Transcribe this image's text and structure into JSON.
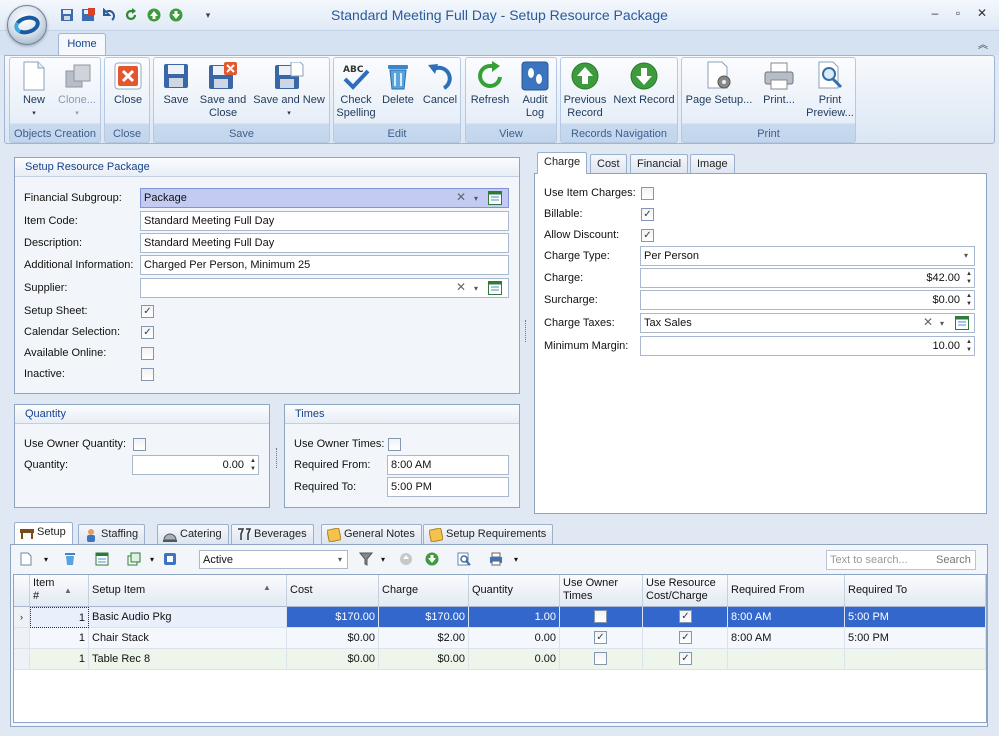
{
  "window": {
    "title": "Standard Meeting Full Day - Setup Resource Package",
    "minimize": "–",
    "maximize": "▫",
    "close": "✕"
  },
  "ribbon": {
    "tab_home": "Home",
    "groups": {
      "objects": "Objects Creation",
      "close": "Close",
      "save": "Save",
      "edit": "Edit",
      "view": "View",
      "nav": "Records Navigation",
      "print": "Print"
    },
    "buttons": {
      "new": "New",
      "clone": "Clone...",
      "close": "Close",
      "save": "Save",
      "save_close_1": "Save and",
      "save_close_2": "Close",
      "save_new": "Save and New",
      "check_1": "Check",
      "check_2": "Spelling",
      "delete": "Delete",
      "cancel": "Cancel",
      "refresh": "Refresh",
      "audit_1": "Audit",
      "audit_2": "Log",
      "prev_1": "Previous",
      "prev_2": "Record",
      "next": "Next Record",
      "page_setup": "Page Setup...",
      "print": "Print...",
      "preview_1": "Print",
      "preview_2": "Preview..."
    }
  },
  "setup_panel": {
    "title": "Setup Resource Package",
    "financial_subgroup_label": "Financial Subgroup:",
    "financial_subgroup": "Package",
    "item_code_label": "Item Code:",
    "item_code": "Standard Meeting Full Day",
    "description_label": "Description:",
    "description": "Standard Meeting Full Day",
    "additional_info_label": "Additional Information:",
    "additional_info": "Charged Per Person, Minimum 25",
    "supplier_label": "Supplier:",
    "supplier": "",
    "setup_sheet_label": "Setup Sheet:",
    "calendar_selection_label": "Calendar Selection:",
    "available_online_label": "Available Online:",
    "inactive_label": "Inactive:"
  },
  "quantity_panel": {
    "title": "Quantity",
    "use_owner_label": "Use Owner Quantity:",
    "quantity_label": "Quantity:",
    "quantity": "0.00"
  },
  "times_panel": {
    "title": "Times",
    "use_owner_label": "Use Owner Times:",
    "required_from_label": "Required From:",
    "required_from": "8:00 AM",
    "required_to_label": "Required To:",
    "required_to": "5:00 PM"
  },
  "charge_tabs": [
    "Charge",
    "Cost",
    "Financial",
    "Image"
  ],
  "charge_panel": {
    "use_item_charges_label": "Use Item Charges:",
    "billable_label": "Billable:",
    "allow_discount_label": "Allow Discount:",
    "charge_type_label": "Charge Type:",
    "charge_type": "Per Person",
    "charge_label": "Charge:",
    "charge": "$42.00",
    "surcharge_label": "Surcharge:",
    "surcharge": "$0.00",
    "charge_taxes_label": "Charge Taxes:",
    "charge_taxes": "Tax Sales",
    "minimum_margin_label": "Minimum Margin:",
    "minimum_margin": "10.00"
  },
  "bottom_tabs": [
    "Setup",
    "Staffing",
    "Catering",
    "Beverages",
    "General Notes",
    "Setup Requirements"
  ],
  "grid_toolbar": {
    "filter_value": "Active",
    "search_placeholder": "Text to search...",
    "search_button": "Search"
  },
  "grid": {
    "headers": {
      "item_1": "Item",
      "item_2": "#",
      "setup_item": "Setup Item",
      "cost": "Cost",
      "charge": "Charge",
      "quantity": "Quantity",
      "use_owner_1": "Use Owner",
      "use_owner_2": "Times",
      "use_resource_1": "Use Resource",
      "use_resource_2": "Cost/Charge",
      "required_from": "Required From",
      "required_to": "Required To"
    },
    "rows": [
      {
        "item": "1",
        "name": "Basic Audio Pkg",
        "cost": "$170.00",
        "charge": "$170.00",
        "quantity": "1.00",
        "use_owner": false,
        "use_resource": true,
        "from": "8:00 AM",
        "to": "5:00 PM"
      },
      {
        "item": "1",
        "name": "Chair Stack",
        "cost": "$0.00",
        "charge": "$2.00",
        "quantity": "0.00",
        "use_owner": true,
        "use_resource": true,
        "from": "8:00 AM",
        "to": "5:00 PM"
      },
      {
        "item": "1",
        "name": "Table Rec 8",
        "cost": "$0.00",
        "charge": "$0.00",
        "quantity": "0.00",
        "use_owner": false,
        "use_resource": true,
        "from": "",
        "to": ""
      }
    ]
  }
}
